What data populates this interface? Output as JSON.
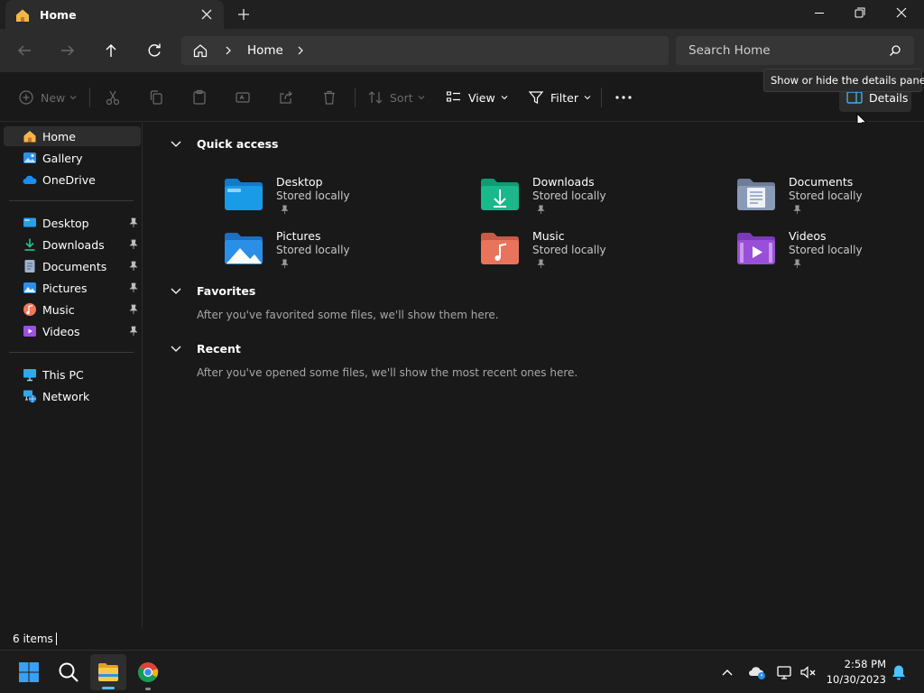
{
  "window": {
    "tab_title": "Home",
    "tooltip": "Show or hide the details pane."
  },
  "address": {
    "crumb": "Home",
    "search_placeholder": "Search Home"
  },
  "commands": {
    "new": "New",
    "sort": "Sort",
    "view": "View",
    "filter": "Filter",
    "details": "Details"
  },
  "sidebar": {
    "top": [
      {
        "label": "Home",
        "icon": "home-icon",
        "selected": true
      },
      {
        "label": "Gallery",
        "icon": "gallery-icon"
      },
      {
        "label": "OneDrive",
        "icon": "onedrive-icon"
      }
    ],
    "pinned": [
      {
        "label": "Desktop",
        "icon": "desktop-icon"
      },
      {
        "label": "Downloads",
        "icon": "downloads-icon"
      },
      {
        "label": "Documents",
        "icon": "documents-icon"
      },
      {
        "label": "Pictures",
        "icon": "pictures-icon"
      },
      {
        "label": "Music",
        "icon": "music-icon"
      },
      {
        "label": "Videos",
        "icon": "videos-icon"
      }
    ],
    "bottom": [
      {
        "label": "This PC",
        "icon": "this-pc-icon"
      },
      {
        "label": "Network",
        "icon": "network-icon"
      }
    ]
  },
  "main": {
    "quick_access": {
      "heading": "Quick access",
      "items": [
        {
          "name": "Desktop",
          "status": "Stored locally",
          "icon": "desktop-folder-icon",
          "color": "#1a9be6"
        },
        {
          "name": "Downloads",
          "status": "Stored locally",
          "icon": "downloads-folder-icon",
          "color": "#1ab88a"
        },
        {
          "name": "Documents",
          "status": "Stored locally",
          "icon": "documents-folder-icon",
          "color": "#8a9bb8"
        },
        {
          "name": "Pictures",
          "status": "Stored locally",
          "icon": "pictures-folder-icon",
          "color": "#2b8fe8"
        },
        {
          "name": "Music",
          "status": "Stored locally",
          "icon": "music-folder-icon",
          "color": "#e8745c"
        },
        {
          "name": "Videos",
          "status": "Stored locally",
          "icon": "videos-folder-icon",
          "color": "#9a4fd8"
        }
      ]
    },
    "favorites": {
      "heading": "Favorites",
      "message": "After you've favorited some files, we'll show them here."
    },
    "recent": {
      "heading": "Recent",
      "message": "After you've opened some files, we'll show the most recent ones here."
    }
  },
  "status": {
    "item_count": "6 items"
  },
  "taskbar": {
    "time": "2:58 PM",
    "date": "10/30/2023",
    "accent": "#4cc2ff"
  }
}
